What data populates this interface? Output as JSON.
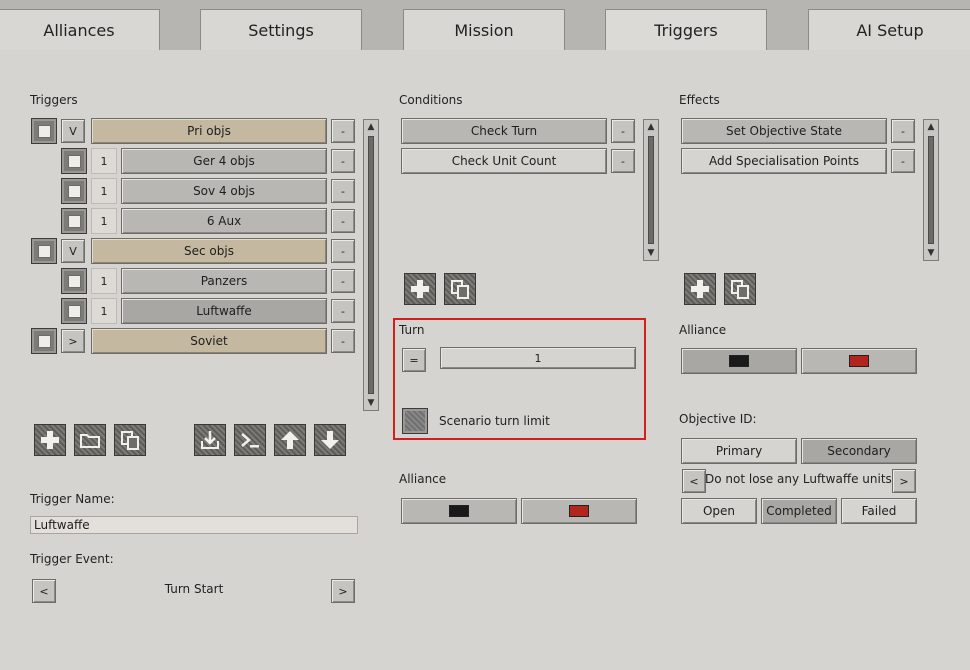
{
  "tabs": [
    "Alliances",
    "Settings",
    "Mission",
    "Triggers",
    "AI Setup"
  ],
  "triggers": {
    "heading": "Triggers",
    "rows": [
      {
        "expander": "V",
        "label": "Pri objs",
        "group": true,
        "remove": "-"
      },
      {
        "expander": "1",
        "label": "Ger 4 objs",
        "group": false,
        "remove": "-"
      },
      {
        "expander": "1",
        "label": "Sov 4 objs",
        "group": false,
        "remove": "-"
      },
      {
        "expander": "1",
        "label": "6 Aux",
        "group": false,
        "remove": "-"
      },
      {
        "expander": "V",
        "label": "Sec objs",
        "group": true,
        "remove": "-"
      },
      {
        "expander": "1",
        "label": "Panzers",
        "group": false,
        "remove": "-"
      },
      {
        "expander": "1",
        "label": "Luftwaffe",
        "group": false,
        "remove": "-"
      },
      {
        "expander": ">",
        "label": "Soviet",
        "group": true,
        "remove": "-"
      }
    ],
    "toolbar": [
      "add-icon",
      "folder-icon",
      "copy-icon",
      "import-icon",
      "console-icon",
      "move-up-icon",
      "move-down-icon"
    ],
    "name_label": "Trigger Name:",
    "name_value": "Luftwaffe",
    "event_label": "Trigger Event:",
    "event_prev": "<",
    "event_value": "Turn Start",
    "event_next": ">"
  },
  "conditions": {
    "heading": "Conditions",
    "items": [
      {
        "label": "Check Turn",
        "remove": "-"
      },
      {
        "label": "Check Unit Count",
        "remove": "-"
      }
    ],
    "turn": {
      "heading": "Turn",
      "operator": "=",
      "value": "1",
      "checkbox_label": "Scenario turn limit"
    },
    "alliance_heading": "Alliance",
    "alliance_colors": [
      "#1a1a1a",
      "#b3261e"
    ]
  },
  "effects": {
    "heading": "Effects",
    "items": [
      {
        "label": "Set Objective State",
        "remove": "-"
      },
      {
        "label": "Add Specialisation Points",
        "remove": "-"
      }
    ],
    "alliance_heading": "Alliance",
    "alliance_colors": [
      "#1a1a1a",
      "#b3261e"
    ],
    "objective_heading": "Objective ID:",
    "objective_types": [
      "Primary",
      "Secondary"
    ],
    "objective_prev": "<",
    "objective_name": "Do not lose any Luftwaffe units",
    "objective_next": ">",
    "states": [
      "Open",
      "Completed",
      "Failed"
    ]
  },
  "colors": {
    "highlight": "#d41e1e"
  }
}
